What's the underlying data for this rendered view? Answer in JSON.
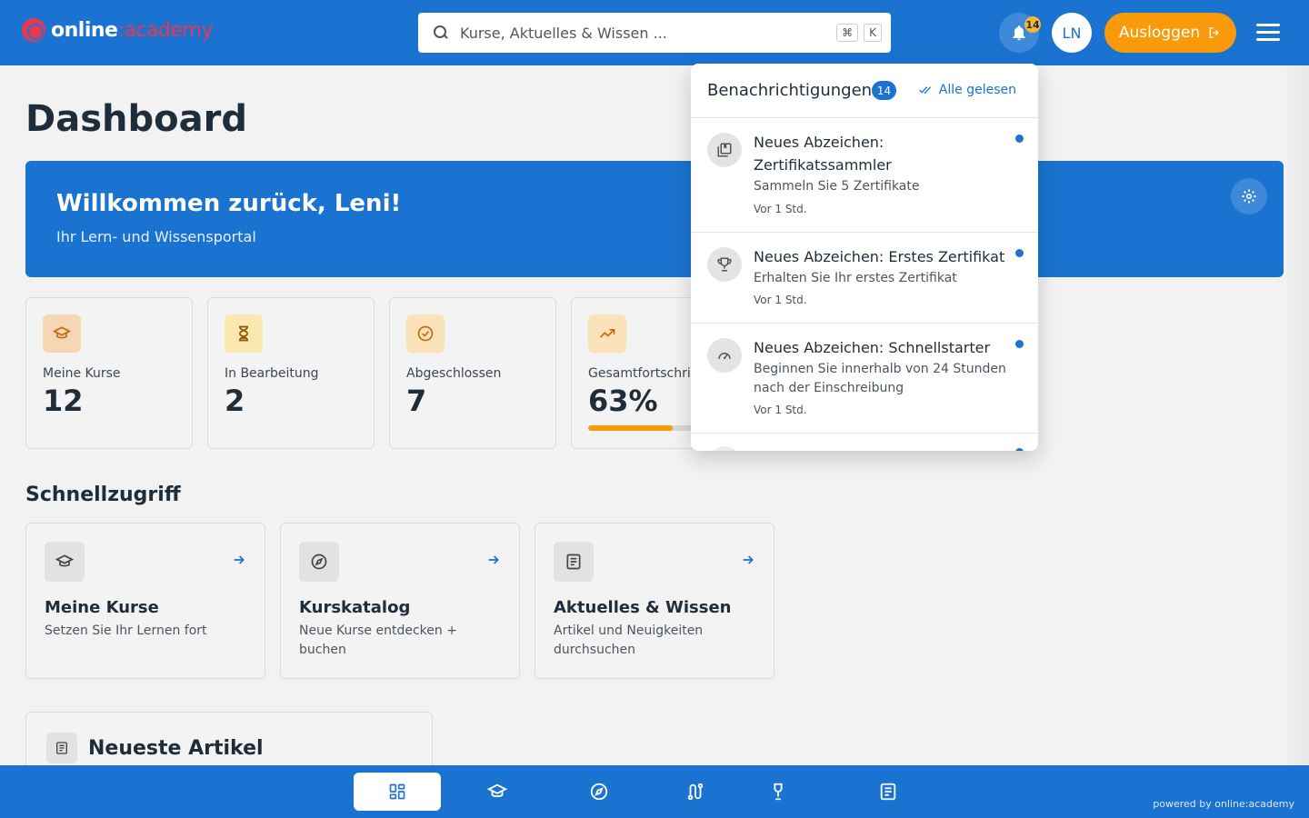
{
  "header": {
    "logo_main": "online",
    "logo_accent": ":academy",
    "search_placeholder": "Kurse, Aktuelles & Wissen ...",
    "search_kbd_1": "⌘",
    "search_kbd_2": "K",
    "notification_badge": "14",
    "avatar_initials": "LN",
    "logout_label": "Ausloggen"
  },
  "page": {
    "title": "Dashboard"
  },
  "welcome": {
    "title": "Willkommen zurück, Leni!",
    "subtitle": "Ihr Lern- und Wissensportal"
  },
  "stats": [
    {
      "label": "Meine Kurse",
      "value": "12",
      "icon": "graduation-cap-icon",
      "color": "#f6d7b3"
    },
    {
      "label": "In Bearbeitung",
      "value": "2",
      "icon": "hourglass-icon",
      "color": "#fbe8b0"
    },
    {
      "label": "Abgeschlossen",
      "value": "7",
      "icon": "check-circle-icon",
      "color": "#fbe2b8"
    },
    {
      "label": "Gesamtfortschritt",
      "value": "63%",
      "icon": "trending-up-icon",
      "color": "#fbe2b8",
      "progress": 0.63
    }
  ],
  "quick_access": {
    "title": "Schnellzugriff",
    "items": [
      {
        "title": "Meine Kurse",
        "subtitle": "Setzen Sie Ihr Lernen fort",
        "icon": "graduation-cap-icon"
      },
      {
        "title": "Kurskatalog",
        "subtitle": "Neue Kurse entdecken + buchen",
        "icon": "compass-icon"
      },
      {
        "title": "Aktuelles & Wissen",
        "subtitle": "Artikel und Neuigkeiten durchsuchen",
        "icon": "article-icon"
      }
    ]
  },
  "articles": {
    "title": "Neueste Artikel"
  },
  "notifications": {
    "title": "Benachrichtigungen",
    "count": "14",
    "mark_all_label": "Alle gelesen",
    "items": [
      {
        "title": "Neues Abzeichen: Zertifikatssammler",
        "description": "Sammeln Sie 5 Zertifikate",
        "time": "Vor 1 Std.",
        "icon": "certificates-icon",
        "unread": true
      },
      {
        "title": "Neues Abzeichen: Erstes Zertifikat",
        "description": "Erhalten Sie Ihr erstes Zertifikat",
        "time": "Vor 1 Std.",
        "icon": "trophy-icon",
        "unread": true
      },
      {
        "title": "Neues Abzeichen: Schnellstarter",
        "description": "Beginnen Sie innerhalb von 24 Stunden nach der Einschreibung",
        "time": "Vor 1 Std.",
        "icon": "speedometer-icon",
        "unread": true
      }
    ]
  },
  "bottom_nav": {
    "items": [
      {
        "icon": "dashboard-icon",
        "active": true
      },
      {
        "icon": "graduation-cap-icon",
        "active": false
      },
      {
        "icon": "compass-icon",
        "active": false
      },
      {
        "icon": "learning-path-icon",
        "active": false
      },
      {
        "icon": "award-icon",
        "active": false
      },
      {
        "icon": "article-icon",
        "active": false
      }
    ],
    "powered_by": "powered by online:academy"
  }
}
